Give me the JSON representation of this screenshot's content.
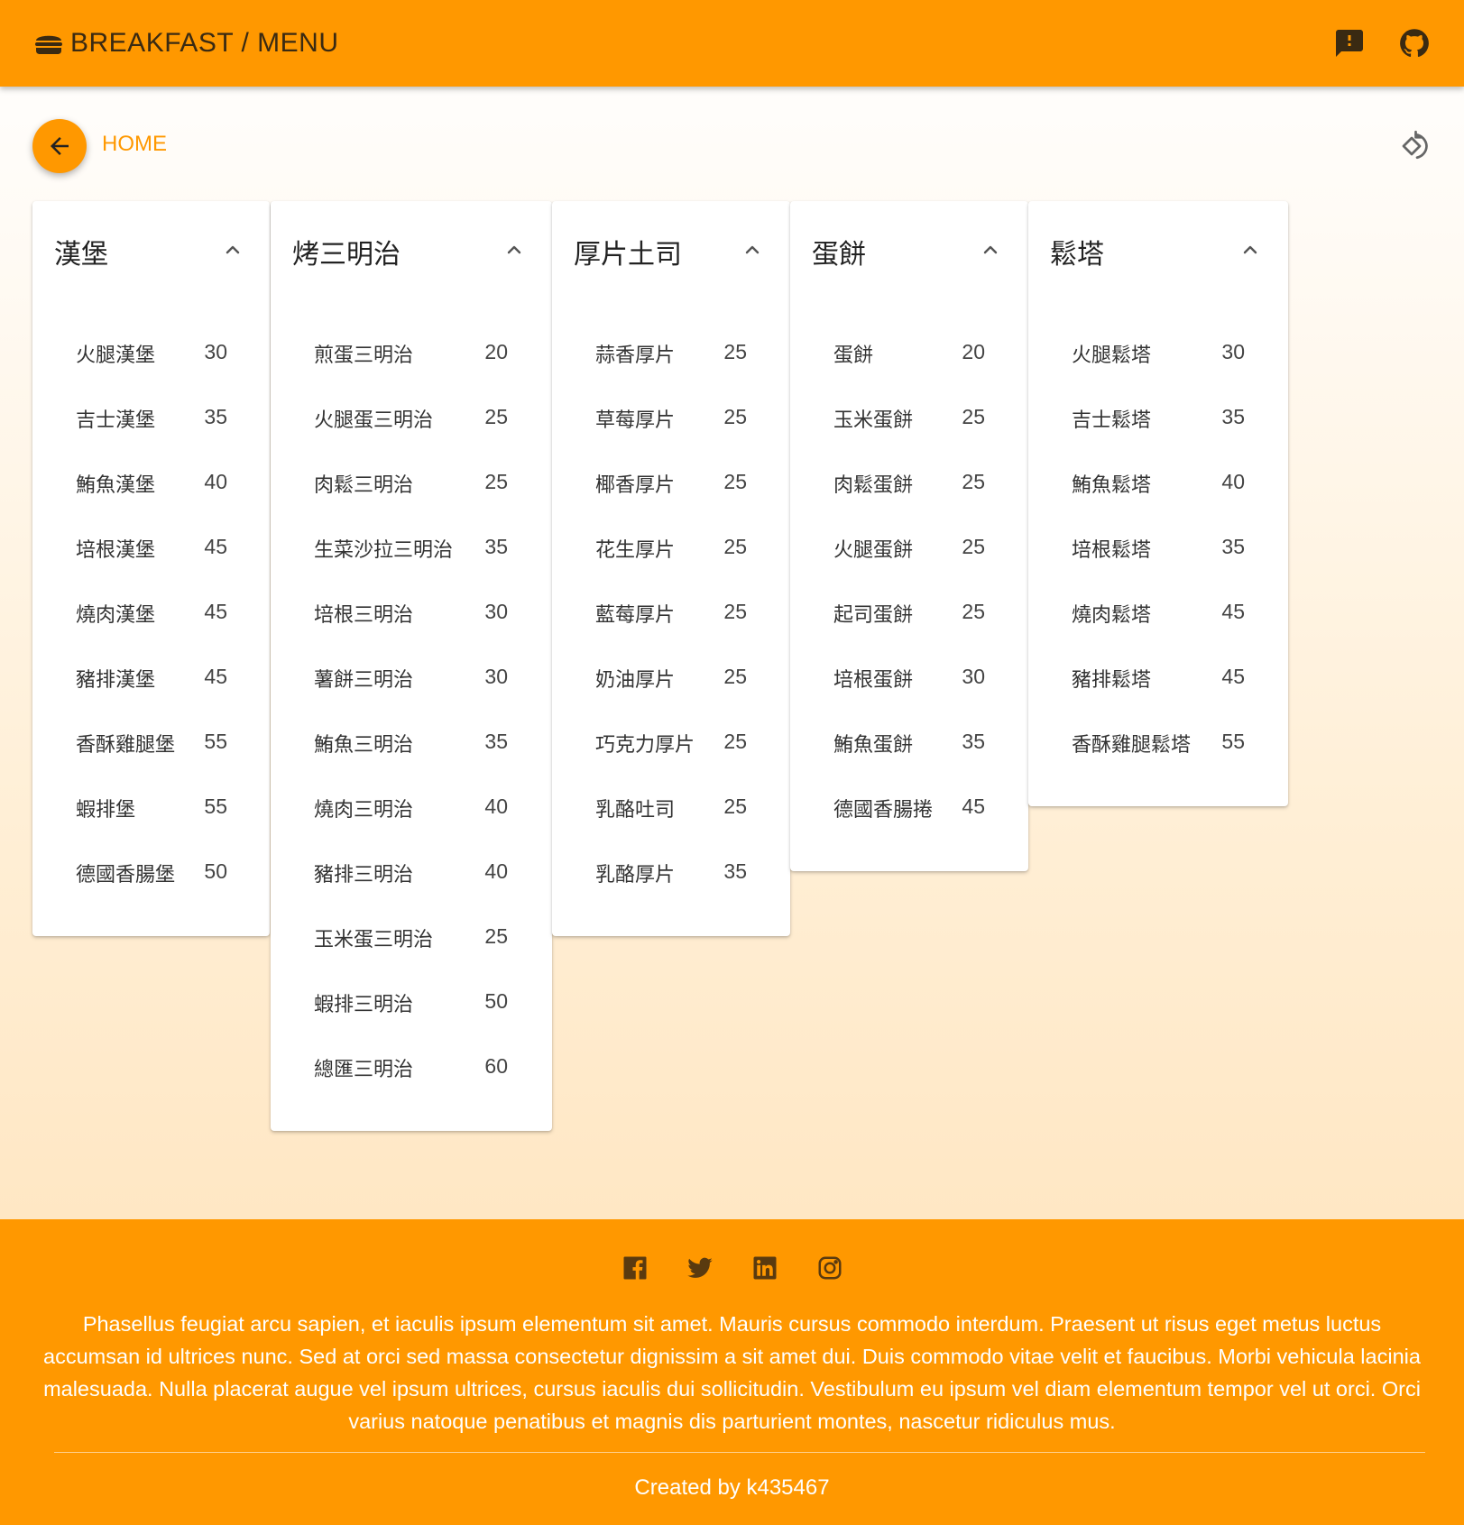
{
  "header": {
    "title": "BREAKFAST / MENU",
    "icons": [
      "hamburger-icon",
      "feedback-icon",
      "github-icon"
    ],
    "color": "#ff9800"
  },
  "nav": {
    "back_icon": "arrow-left-icon",
    "breadcrumb": "HOME",
    "rotate_icon": "screen-rotation-icon"
  },
  "categories": [
    {
      "title": "漢堡",
      "items": [
        {
          "name": "火腿漢堡",
          "price": "30"
        },
        {
          "name": "吉士漢堡",
          "price": "35"
        },
        {
          "name": "鮪魚漢堡",
          "price": "40"
        },
        {
          "name": "培根漢堡",
          "price": "45"
        },
        {
          "name": "燒肉漢堡",
          "price": "45"
        },
        {
          "name": "豬排漢堡",
          "price": "45"
        },
        {
          "name": "香酥雞腿堡",
          "price": "55"
        },
        {
          "name": "蝦排堡",
          "price": "55"
        },
        {
          "name": "德國香腸堡",
          "price": "50"
        }
      ]
    },
    {
      "title": "烤三明治",
      "items": [
        {
          "name": "煎蛋三明治",
          "price": "20"
        },
        {
          "name": "火腿蛋三明治",
          "price": "25"
        },
        {
          "name": "肉鬆三明治",
          "price": "25"
        },
        {
          "name": "生菜沙拉三明治",
          "price": "35"
        },
        {
          "name": "培根三明治",
          "price": "30"
        },
        {
          "name": "薯餅三明治",
          "price": "30"
        },
        {
          "name": "鮪魚三明治",
          "price": "35"
        },
        {
          "name": "燒肉三明治",
          "price": "40"
        },
        {
          "name": "豬排三明治",
          "price": "40"
        },
        {
          "name": "玉米蛋三明治",
          "price": "25"
        },
        {
          "name": "蝦排三明治",
          "price": "50"
        },
        {
          "name": "總匯三明治",
          "price": "60"
        }
      ]
    },
    {
      "title": "厚片土司",
      "items": [
        {
          "name": "蒜香厚片",
          "price": "25"
        },
        {
          "name": "草莓厚片",
          "price": "25"
        },
        {
          "name": "椰香厚片",
          "price": "25"
        },
        {
          "name": "花生厚片",
          "price": "25"
        },
        {
          "name": "藍莓厚片",
          "price": "25"
        },
        {
          "name": "奶油厚片",
          "price": "25"
        },
        {
          "name": "巧克力厚片",
          "price": "25"
        },
        {
          "name": "乳酪吐司",
          "price": "25"
        },
        {
          "name": "乳酪厚片",
          "price": "35"
        }
      ]
    },
    {
      "title": "蛋餅",
      "items": [
        {
          "name": "蛋餅",
          "price": "20"
        },
        {
          "name": "玉米蛋餅",
          "price": "25"
        },
        {
          "name": "肉鬆蛋餅",
          "price": "25"
        },
        {
          "name": "火腿蛋餅",
          "price": "25"
        },
        {
          "name": "起司蛋餅",
          "price": "25"
        },
        {
          "name": "培根蛋餅",
          "price": "30"
        },
        {
          "name": "鮪魚蛋餅",
          "price": "35"
        },
        {
          "name": "德國香腸捲",
          "price": "45"
        }
      ]
    },
    {
      "title": "鬆塔",
      "items": [
        {
          "name": "火腿鬆塔",
          "price": "30"
        },
        {
          "name": "吉士鬆塔",
          "price": "35"
        },
        {
          "name": "鮪魚鬆塔",
          "price": "40"
        },
        {
          "name": "培根鬆塔",
          "price": "35"
        },
        {
          "name": "燒肉鬆塔",
          "price": "45"
        },
        {
          "name": "豬排鬆塔",
          "price": "45"
        },
        {
          "name": "香酥雞腿鬆塔",
          "price": "55"
        }
      ]
    }
  ],
  "footer": {
    "social_icons": [
      "facebook-icon",
      "twitter-icon",
      "linkedin-icon",
      "instagram-icon"
    ],
    "text": "Phasellus feugiat arcu sapien, et iaculis ipsum elementum sit amet. Mauris cursus commodo interdum. Praesent ut risus eget metus luctus accumsan id ultrices nunc. Sed at orci sed massa consectetur dignissim a sit amet dui. Duis commodo vitae velit et faucibus. Morbi vehicula lacinia malesuada. Nulla placerat augue vel ipsum ultrices, cursus iaculis dui sollicitudin. Vestibulum eu ipsum vel diam elementum tempor vel ut orci. Orci varius natoque penatibus et magnis dis parturient montes, nascetur ridiculus mus.",
    "credit": "Created by k435467"
  }
}
